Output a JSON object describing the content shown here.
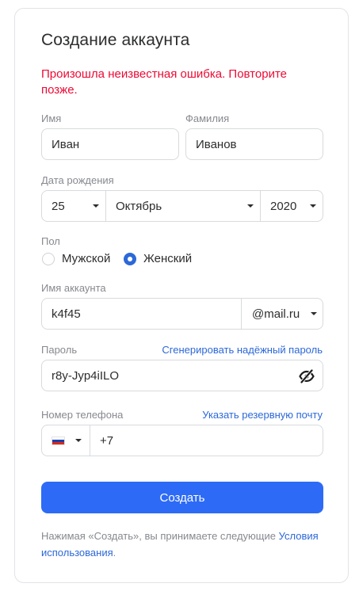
{
  "title": "Создание аккаунта",
  "error": "Произошла неизвестная ошибка. Повторите позже.",
  "first_name": {
    "label": "Имя",
    "value": "Иван"
  },
  "last_name": {
    "label": "Фамилия",
    "value": "Иванов"
  },
  "birth_date": {
    "label": "Дата рождения",
    "day": "25",
    "month": "Октябрь",
    "year": "2020"
  },
  "gender": {
    "label": "Пол",
    "male": "Мужской",
    "female": "Женский",
    "selected": "female"
  },
  "account": {
    "label": "Имя аккаунта",
    "value": "k4f45",
    "domain": "@mail.ru"
  },
  "password": {
    "label": "Пароль",
    "generate_link": "Сгенерировать надёжный пароль",
    "value": "r8y-Jyp4iILO",
    "visibility_icon": "eye-slash-icon"
  },
  "phone": {
    "label": "Номер телефона",
    "backup_email_link": "Указать резервную почту",
    "value": "+7",
    "country_icon": "russia-flag-icon"
  },
  "submit_label": "Создать",
  "terms": {
    "text": "Нажимая «Создать», вы принимаете следующие ",
    "link": "Условия использования",
    "end": "."
  },
  "colors": {
    "accent": "#2d6bf7",
    "link": "#2c68d8",
    "error": "#ed0a34"
  }
}
